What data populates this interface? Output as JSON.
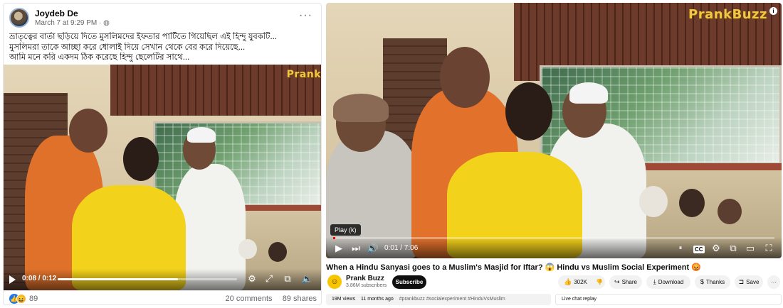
{
  "facebook": {
    "author": "Joydeb De",
    "date": "March 7 at 9:29 PM",
    "privacy_icon": "globe-icon",
    "more_icon": "more-horizontal-icon",
    "caption_lines": [
      "ভ্রাতৃত্বের বার্তা ছড়িয়ে দিতে মুসলিমদের ইফতার পার্টিতে গিয়েছিল এই হিন্দু যুবকটি...",
      "মুসলিমরা তাকে আচ্ছা করে ধোলাই দিয়ে সেখান থেকে বের করে দিয়েছে...",
      "আমি মনে করি একদম ঠিক করেছে হিন্দু ছেলেটির সাথে..."
    ],
    "watermark": "Prank",
    "player": {
      "time": "0:08 / 0:12",
      "progress": 0.67,
      "controls": [
        "settings-icon",
        "fullscreen-icon",
        "picture-in-picture-icon",
        "volume-icon"
      ]
    },
    "reactions": {
      "icons": [
        "like-icon",
        "haha-icon"
      ],
      "count": "89",
      "comments": "20 comments",
      "shares": "89 shares"
    }
  },
  "youtube": {
    "watermark": "PrankBuzz",
    "tooltip": "Play (k)",
    "player": {
      "time": "0:01 / 7:06",
      "progress": 0.003,
      "left_controls": [
        "play-icon",
        "next-icon",
        "volume-icon"
      ],
      "right_controls": [
        "autoplay-toggle-icon",
        "cc-icon",
        "settings-icon",
        "miniplayer-icon",
        "theater-icon",
        "fullscreen-icon"
      ]
    },
    "title": "When a Hindu Sanyasi goes to a Muslim's Masjid for Iftar? 😱 Hindu vs Muslim Social Experiment 😡",
    "channel": {
      "name": "Prank Buzz",
      "subscribers": "3.86M subscribers",
      "subscribe_label": "Subscribe"
    },
    "actions": {
      "likes": "302K",
      "share": "Share",
      "download": "Download",
      "thanks": "Thanks",
      "save": "Save"
    },
    "description": {
      "views": "19M views",
      "age": "11 months ago",
      "tags": "#prankbuzz #socialexperiment #HinduVsMuslim"
    },
    "chat_replay": "Live chat replay"
  }
}
